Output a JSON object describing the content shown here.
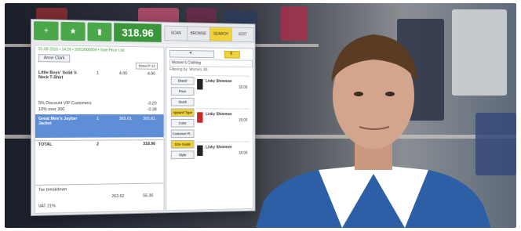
{
  "topbar": {
    "add_label": "+",
    "favorite_label": "★",
    "clipboard_label": "▮",
    "total": "318.96",
    "tabs": [
      "SCAN",
      "BROWSE",
      "SEARCH",
      "EDIT"
    ]
  },
  "ticket": {
    "header": "31-08-2016 • 14:26 • 2001/000004 • Sale Price List",
    "customer": "Anne Clark",
    "store": "Street P 12",
    "items": [
      {
        "name": "Little Boys' Solid V-Neck T-Shirt",
        "qty": "1",
        "price": "4.00",
        "total": "4.00"
      },
      {
        "name": "Great Men's Jaylon Jacket",
        "qty": "1",
        "price": "365.61",
        "total": "365.61"
      }
    ],
    "discounts": [
      {
        "label": "5% Discount VIP Customers",
        "value": "-0.20"
      },
      {
        "label": "10% over 300",
        "value": "-0.38"
      }
    ],
    "total_label": "TOTAL",
    "total_qty": "2",
    "total_value": "318.96",
    "tax_label": "Tax breakdown",
    "vat_label": "VAT 21%",
    "vat_base": "263.62",
    "vat_value": "55.36"
  },
  "browse": {
    "dropdown": "Women's Clothing",
    "filter": "Filtering by: Women, All",
    "categories": [
      "Brand",
      "Price",
      "Stock",
      "Apparel Type",
      "Color",
      "Customer R...",
      "Size Guide",
      "Style"
    ],
    "products": [
      {
        "name": "Linky Shimmee",
        "price": "18.00"
      },
      {
        "name": "Linky Shimmee",
        "price": "19.00"
      },
      {
        "name": "Linky Shimmee",
        "price": "18.00"
      }
    ]
  }
}
